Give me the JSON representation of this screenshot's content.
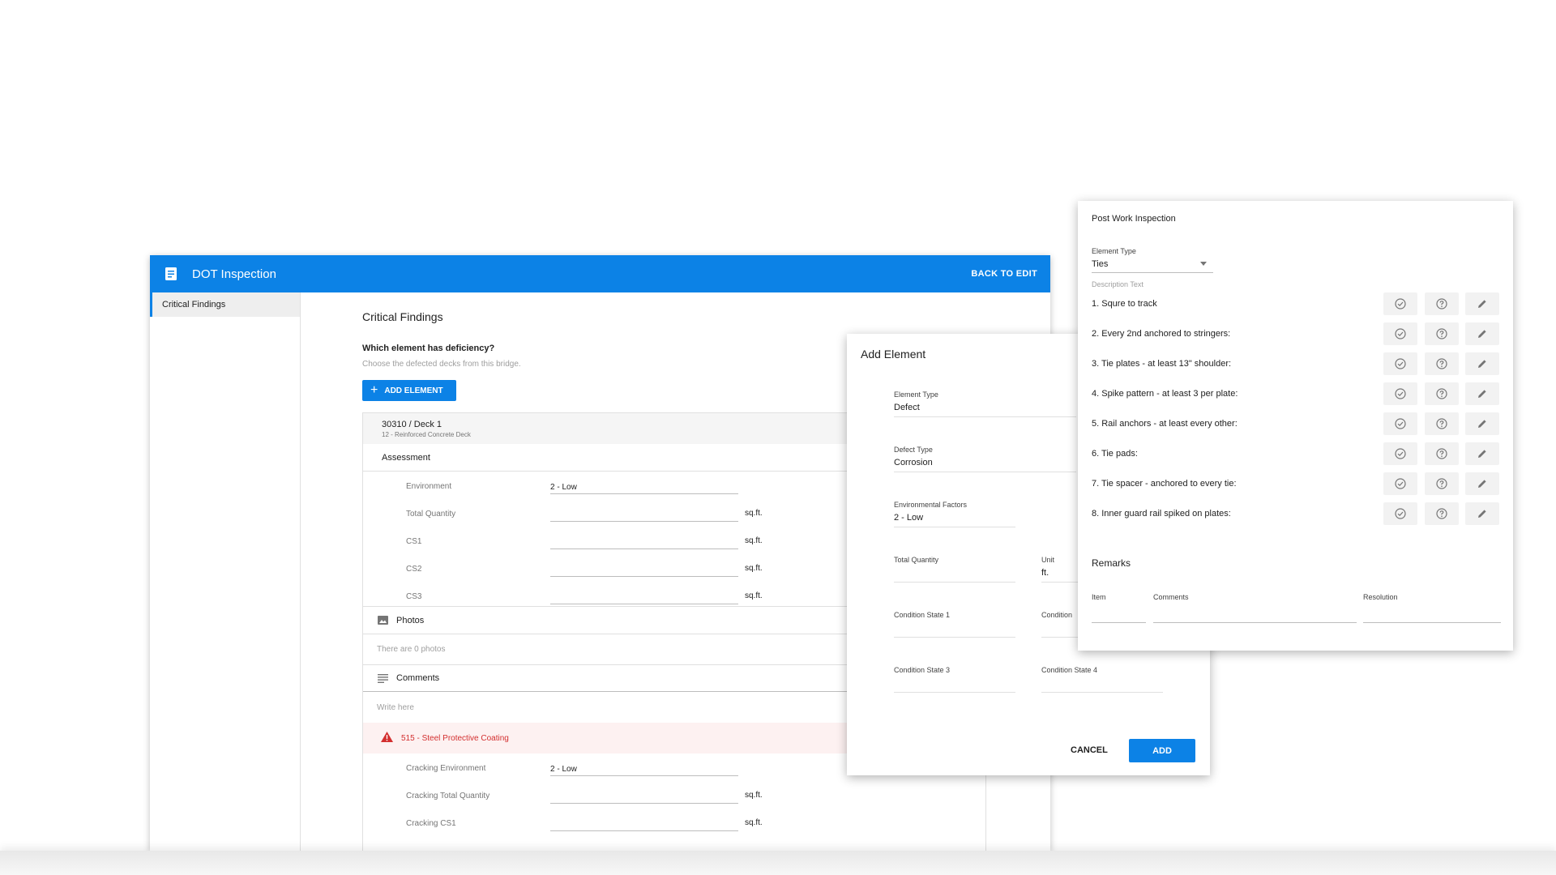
{
  "app": {
    "title": "DOT Inspection",
    "back_label": "BACK TO EDIT",
    "accent": "#0c82e6",
    "sidebar": {
      "items": [
        {
          "label": "Critical Findings"
        }
      ]
    },
    "main": {
      "heading": "Critical Findings",
      "question": "Which element has deficiency?",
      "hint": "Choose the defected decks from this bridge.",
      "add_element_label": "ADD ELEMENT",
      "card": {
        "title": "30310 / Deck 1",
        "subtitle": "12 - Reinforced Concrete Deck",
        "assessment_label": "Assessment",
        "rows": [
          {
            "label": "Environment",
            "value": "2 - Low",
            "unit": ""
          },
          {
            "label": "Total Quantity",
            "value": "",
            "unit": "sq.ft."
          },
          {
            "label": "CS1",
            "value": "",
            "unit": "sq.ft."
          },
          {
            "label": "CS2",
            "value": "",
            "unit": "sq.ft."
          },
          {
            "label": "CS3",
            "value": "",
            "unit": "sq.ft."
          }
        ],
        "photos_label": "Photos",
        "photos_text": "There are 0 photos",
        "comments_label": "Comments",
        "comments_placeholder": "Write here",
        "warning_label": "515 - Steel Protective Coating",
        "warning_color": "#d32f2f",
        "cracking_rows": [
          {
            "label": "Cracking Environment",
            "value": "2 - Low",
            "unit": ""
          },
          {
            "label": "Cracking Total Quantity",
            "value": "",
            "unit": "sq.ft."
          },
          {
            "label": "Cracking CS1",
            "value": "",
            "unit": "sq.ft."
          }
        ]
      }
    }
  },
  "add_element_dialog": {
    "title": "Add Element",
    "fields": {
      "element_type": {
        "label": "Element Type",
        "value": "Defect"
      },
      "defect_type": {
        "label": "Defect Type",
        "value": "Corrosion"
      },
      "env_factors": {
        "label": "Environmental Factors",
        "value": "2 - Low"
      },
      "total_quantity": {
        "label": "Total Quantity",
        "value": ""
      },
      "unit": {
        "label": "Unit",
        "value": "ft."
      },
      "cs1": {
        "label": "Condition State 1",
        "value": ""
      },
      "cs2": {
        "label": "Condition",
        "value": ""
      },
      "cs3": {
        "label": "Condition State 3",
        "value": ""
      },
      "cs4": {
        "label": "Condition State 4",
        "value": ""
      }
    },
    "cancel_label": "CANCEL",
    "add_label": "ADD"
  },
  "post_work_inspection": {
    "title": "Post Work Inspection",
    "element_type_label": "Element Type",
    "element_type_value": "Ties",
    "description_label": "Description Text",
    "items": [
      "1. Squre to track",
      "2. Every 2nd anchored to stringers:",
      "3. Tie plates - at least 13\" shoulder:",
      "4. Spike pattern - at least 3 per plate:",
      "5. Rail anchors - at least every other:",
      "6. Tie pads:",
      "7. Tie spacer - anchored to every tie:",
      "8. Inner guard rail spiked on plates:"
    ],
    "remarks_label": "Remarks",
    "remarks_columns": {
      "item": "Item",
      "comments": "Comments",
      "resolution": "Resolution"
    }
  }
}
